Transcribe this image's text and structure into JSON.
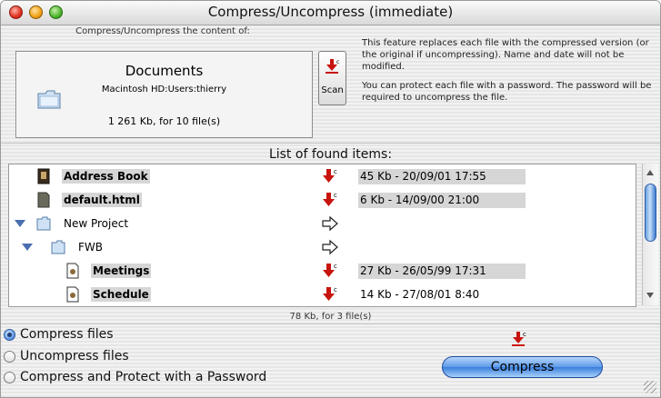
{
  "window": {
    "title": "Compress/Uncompress (immediate)"
  },
  "source": {
    "label": "Compress/Uncompress the content of:",
    "name": "Documents",
    "path": "Macintosh HD:Users:thierry",
    "size_text": "1 261 Kb, for 10 file(s)",
    "scan_label": "Scan"
  },
  "info": {
    "para1": "This feature replaces each file with the compressed version (or the original if uncompressing). Name and date will not be modified.",
    "para2": "You can protect each file with a password. The password will be required to uncompress the file."
  },
  "list": {
    "title": "List of found items:",
    "rows": [
      {
        "name": "Address Book",
        "info": "45 Kb - 20/09/01 17:55",
        "icon": "address-book-icon",
        "action": "compress-arrow-icon"
      },
      {
        "name": "default.html",
        "info": "6 Kb - 14/09/00 21:00",
        "icon": "html-file-icon",
        "action": "compress-arrow-icon"
      },
      {
        "name": "New Project",
        "info": "",
        "icon": "folder-icon",
        "action": "right-arrow-icon"
      },
      {
        "name": "FWB",
        "info": "",
        "icon": "folder-icon",
        "action": "right-arrow-icon"
      },
      {
        "name": "Meetings",
        "info": "27 Kb - 26/05/99 17:31",
        "icon": "document-icon",
        "action": "compress-arrow-icon"
      },
      {
        "name": "Schedule",
        "info": "14 Kb - 27/08/01 8:40",
        "icon": "document-icon",
        "action": "compress-arrow-icon"
      }
    ],
    "summary": "78 Kb, for 3 file(s)"
  },
  "options": {
    "compress": "Compress files",
    "uncompress": "Uncompress files",
    "protect": "Compress and Protect with a Password",
    "selected": "compress"
  },
  "action_button": "Compress",
  "colors": {
    "accent": "#3a7fdc",
    "compress_arrow": "#c8140e"
  }
}
